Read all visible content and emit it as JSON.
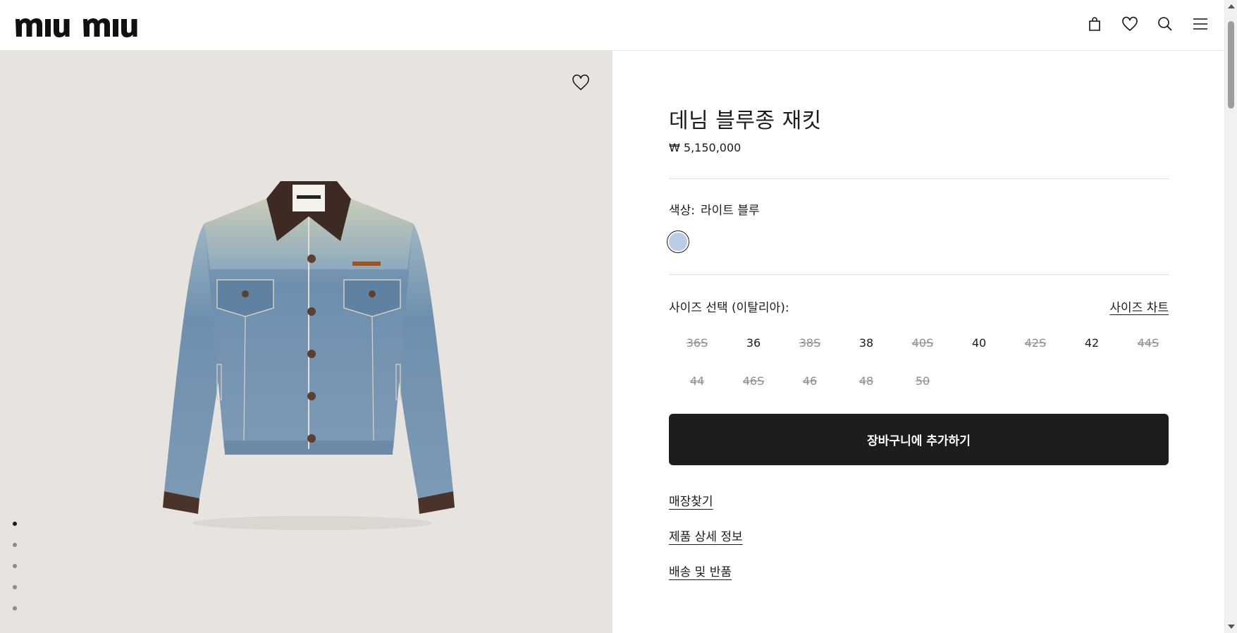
{
  "header": {
    "logo_text": "miu miu",
    "icons": [
      "shopping-bag-icon",
      "heart-icon",
      "search-icon",
      "menu-icon"
    ]
  },
  "gallery": {
    "image_count": 5,
    "active_index": 0
  },
  "product": {
    "title": "데님 블루종 재킷",
    "price": "₩ 5,150,000",
    "color_label": "색상:",
    "color_value": "라이트 블루",
    "swatch_color": "#b9cde6",
    "size_label": "사이즈 선택 (이탈리아):",
    "size_chart_label": "사이즈 차트",
    "sizes": [
      {
        "label": "36S",
        "available": false
      },
      {
        "label": "36",
        "available": true
      },
      {
        "label": "38S",
        "available": false
      },
      {
        "label": "38",
        "available": true
      },
      {
        "label": "40S",
        "available": false
      },
      {
        "label": "40",
        "available": true
      },
      {
        "label": "42S",
        "available": false
      },
      {
        "label": "42",
        "available": true
      },
      {
        "label": "44S",
        "available": false
      },
      {
        "label": "44",
        "available": false
      },
      {
        "label": "46S",
        "available": false
      },
      {
        "label": "46",
        "available": false
      },
      {
        "label": "48",
        "available": false
      },
      {
        "label": "50",
        "available": false
      }
    ],
    "add_to_cart_label": "장바구니에 추가하기",
    "links": [
      "매장찾기",
      "제품 상세 정보",
      "배송 및 반품"
    ]
  },
  "colors": {
    "gallery_bg": "#e7e3de",
    "button_bg": "#1c1d1f",
    "unavailable_text": "#8d8d8d"
  }
}
